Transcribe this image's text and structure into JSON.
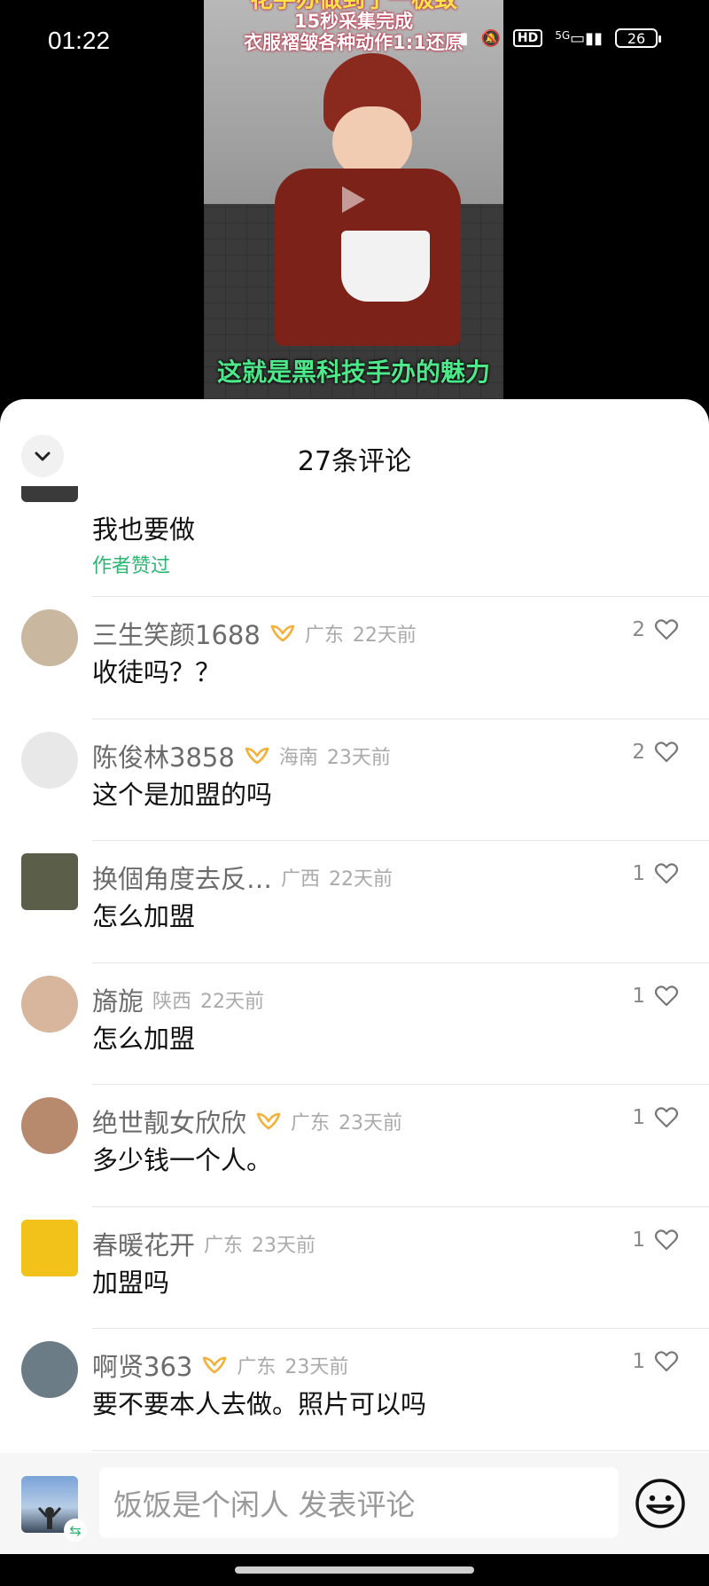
{
  "status": {
    "time": "01:22",
    "network": "5G",
    "hd": "HD",
    "battery": "26"
  },
  "video": {
    "title_lines": [
      "花手办做到了一极致",
      "15秒采集完成",
      "衣服褶皱各种动作1:1还原"
    ],
    "caption": "这就是黑科技手办的魅力"
  },
  "sheet": {
    "title": "27条评论"
  },
  "first_comment": {
    "text": "我也要做",
    "author_liked": "作者赞过"
  },
  "comments": [
    {
      "username": "三生笑颜1688",
      "badge": true,
      "location": "广东",
      "time": "22天前",
      "text": "收徒吗？？",
      "likes": "2",
      "avatar_color": "#c9b79f"
    },
    {
      "username": "陈俊林3858",
      "badge": true,
      "location": "海南",
      "time": "23天前",
      "text": "这个是加盟的吗",
      "likes": "2",
      "avatar_color": "#e8e8e8"
    },
    {
      "username": "换個角度去反…",
      "badge": false,
      "location": "广西",
      "time": "22天前",
      "text": "怎么加盟",
      "likes": "1",
      "avatar_color": "#5b5f4a"
    },
    {
      "username": "旖旎",
      "badge": false,
      "location": "陕西",
      "time": "22天前",
      "text": "怎么加盟",
      "likes": "1",
      "avatar_color": "#d8b59d"
    },
    {
      "username": "绝世靓女欣欣",
      "badge": true,
      "location": "广东",
      "time": "23天前",
      "text": "多少钱一个人。",
      "likes": "1",
      "avatar_color": "#b88a6d"
    },
    {
      "username": "春暖花开",
      "badge": false,
      "location": "广东",
      "time": "23天前",
      "text": "加盟吗",
      "likes": "1",
      "avatar_color": "#f2c21a"
    },
    {
      "username": "啊贤363",
      "badge": true,
      "location": "广东",
      "time": "23天前",
      "text": "要不要本人去做。照片可以吗",
      "likes": "1",
      "avatar_color": "#6b7c86"
    }
  ],
  "input": {
    "placeholder": "饭饭是个闲人 发表评论"
  }
}
